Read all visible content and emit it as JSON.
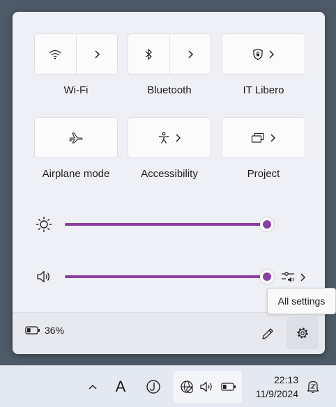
{
  "colors": {
    "accent": "#8b3fa2",
    "panel": "#eef0f5",
    "desktop": "#4d5a68"
  },
  "tiles": [
    {
      "label": "Wi-Fi",
      "icon": "wifi-icon",
      "has_expand": true
    },
    {
      "label": "Bluetooth",
      "icon": "bluetooth-icon",
      "has_expand": true
    },
    {
      "label": "IT Libero",
      "icon": "vpn-shield-icon",
      "has_expand": true
    },
    {
      "label": "Airplane mode",
      "icon": "airplane-icon",
      "has_expand": false
    },
    {
      "label": "Accessibility",
      "icon": "accessibility-icon",
      "has_expand": true
    },
    {
      "label": "Project",
      "icon": "project-icon",
      "has_expand": true
    }
  ],
  "sliders": {
    "brightness": {
      "icon": "brightness-icon",
      "value": 100
    },
    "volume": {
      "icon": "volume-icon",
      "value": 100
    }
  },
  "footer": {
    "battery_text": "36%",
    "battery_level": 0.36,
    "edit_icon": "pencil-icon",
    "settings_icon": "gear-icon"
  },
  "tooltip": {
    "text": "All settings"
  },
  "taskbar": {
    "chevron_icon": "chevron-up-icon",
    "ime_text": "A",
    "tray_icons": [
      "network-globe-icon",
      "volume-icon",
      "battery-icon"
    ],
    "time": "22:13",
    "date": "11/9/2024",
    "notification_icon": "notification-bell-icon"
  }
}
